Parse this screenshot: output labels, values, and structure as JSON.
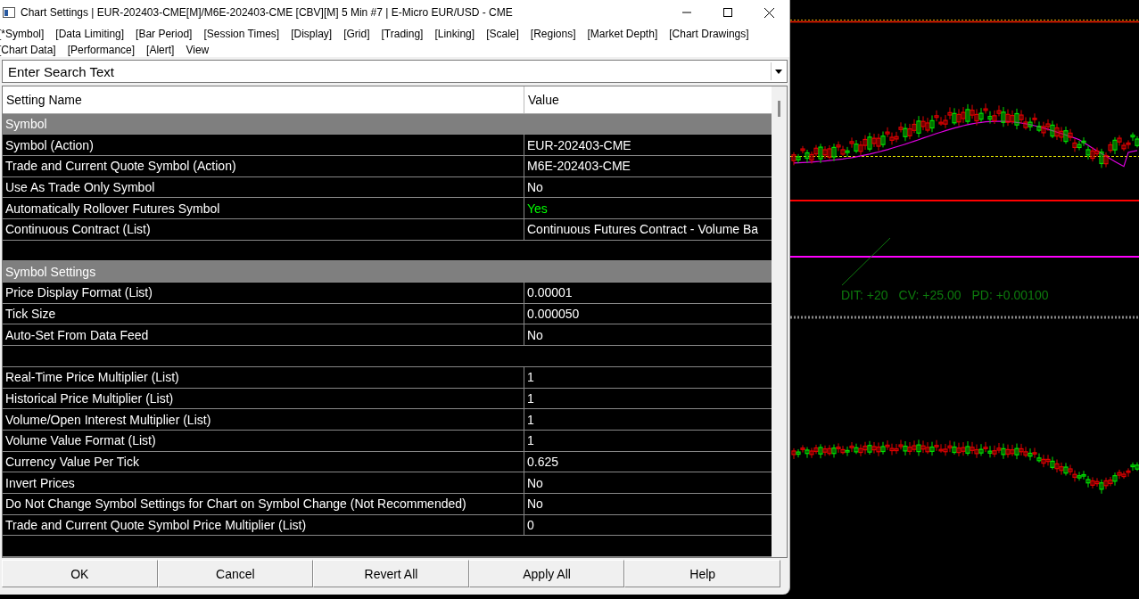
{
  "window": {
    "title": "Chart Settings | EUR-202403-CME[M]/M6E-202403-CME [CBV][M]  5 Min  #7 | E-Micro EUR/USD - CME"
  },
  "tabs": [
    "[*Symbol]",
    "[Data Limiting]",
    "[Bar Period]",
    "[Session Times]",
    "[Display]",
    "[Grid]",
    "[Trading]",
    "[Linking]",
    "[Scale]",
    "[Regions]",
    "[Market Depth]",
    "[Chart Drawings]",
    "[Chart Data]",
    "[Performance]",
    "[Alert]",
    "View"
  ],
  "search": {
    "placeholder": "Enter Search Text"
  },
  "table": {
    "columns": [
      "Setting Name",
      "Value"
    ],
    "rows": [
      {
        "kind": "section",
        "name": "Symbol"
      },
      {
        "kind": "setting",
        "name": "Symbol (Action)",
        "value": "EUR-202403-CME"
      },
      {
        "kind": "setting",
        "name": "Trade and Current Quote Symbol (Action)",
        "value": "M6E-202403-CME"
      },
      {
        "kind": "setting",
        "name": "Use As Trade Only Symbol",
        "value": "No"
      },
      {
        "kind": "setting",
        "name": "Automatically Rollover Futures Symbol",
        "value": "Yes",
        "color": "#00ff00"
      },
      {
        "kind": "setting",
        "name": "Continuous Contract (List)",
        "value": "Continuous Futures Contract - Volume Ba"
      },
      {
        "kind": "blank"
      },
      {
        "kind": "section",
        "name": "Symbol Settings"
      },
      {
        "kind": "setting",
        "name": "Price Display Format (List)",
        "value": "0.00001"
      },
      {
        "kind": "setting",
        "name": "Tick Size",
        "value": "0.000050"
      },
      {
        "kind": "setting",
        "name": "Auto-Set From Data Feed",
        "value": "No"
      },
      {
        "kind": "blank"
      },
      {
        "kind": "setting",
        "name": "Real-Time Price Multiplier (List)",
        "value": "1"
      },
      {
        "kind": "setting",
        "name": "Historical Price Multiplier (List)",
        "value": "1"
      },
      {
        "kind": "setting",
        "name": "Volume/Open Interest Multiplier (List)",
        "value": "1"
      },
      {
        "kind": "setting",
        "name": "Volume Value Format (List)",
        "value": "1"
      },
      {
        "kind": "setting",
        "name": "Currency Value Per Tick",
        "value": "0.625"
      },
      {
        "kind": "setting",
        "name": "Invert Prices",
        "value": "No"
      },
      {
        "kind": "setting",
        "name": "Do Not Change Symbol Settings for Chart on Symbol Change (Not Recommended)",
        "value": "No"
      },
      {
        "kind": "setting",
        "name": "Trade and Current Quote Symbol Price Multiplier (List)",
        "value": "0"
      },
      {
        "kind": "blank"
      }
    ]
  },
  "buttons": [
    "OK",
    "Cancel",
    "Revert All",
    "Apply All",
    "Help"
  ],
  "chart": {
    "readouts": [
      "DIT: +20",
      "CV: +25.00",
      "PD: +0.00100"
    ]
  }
}
